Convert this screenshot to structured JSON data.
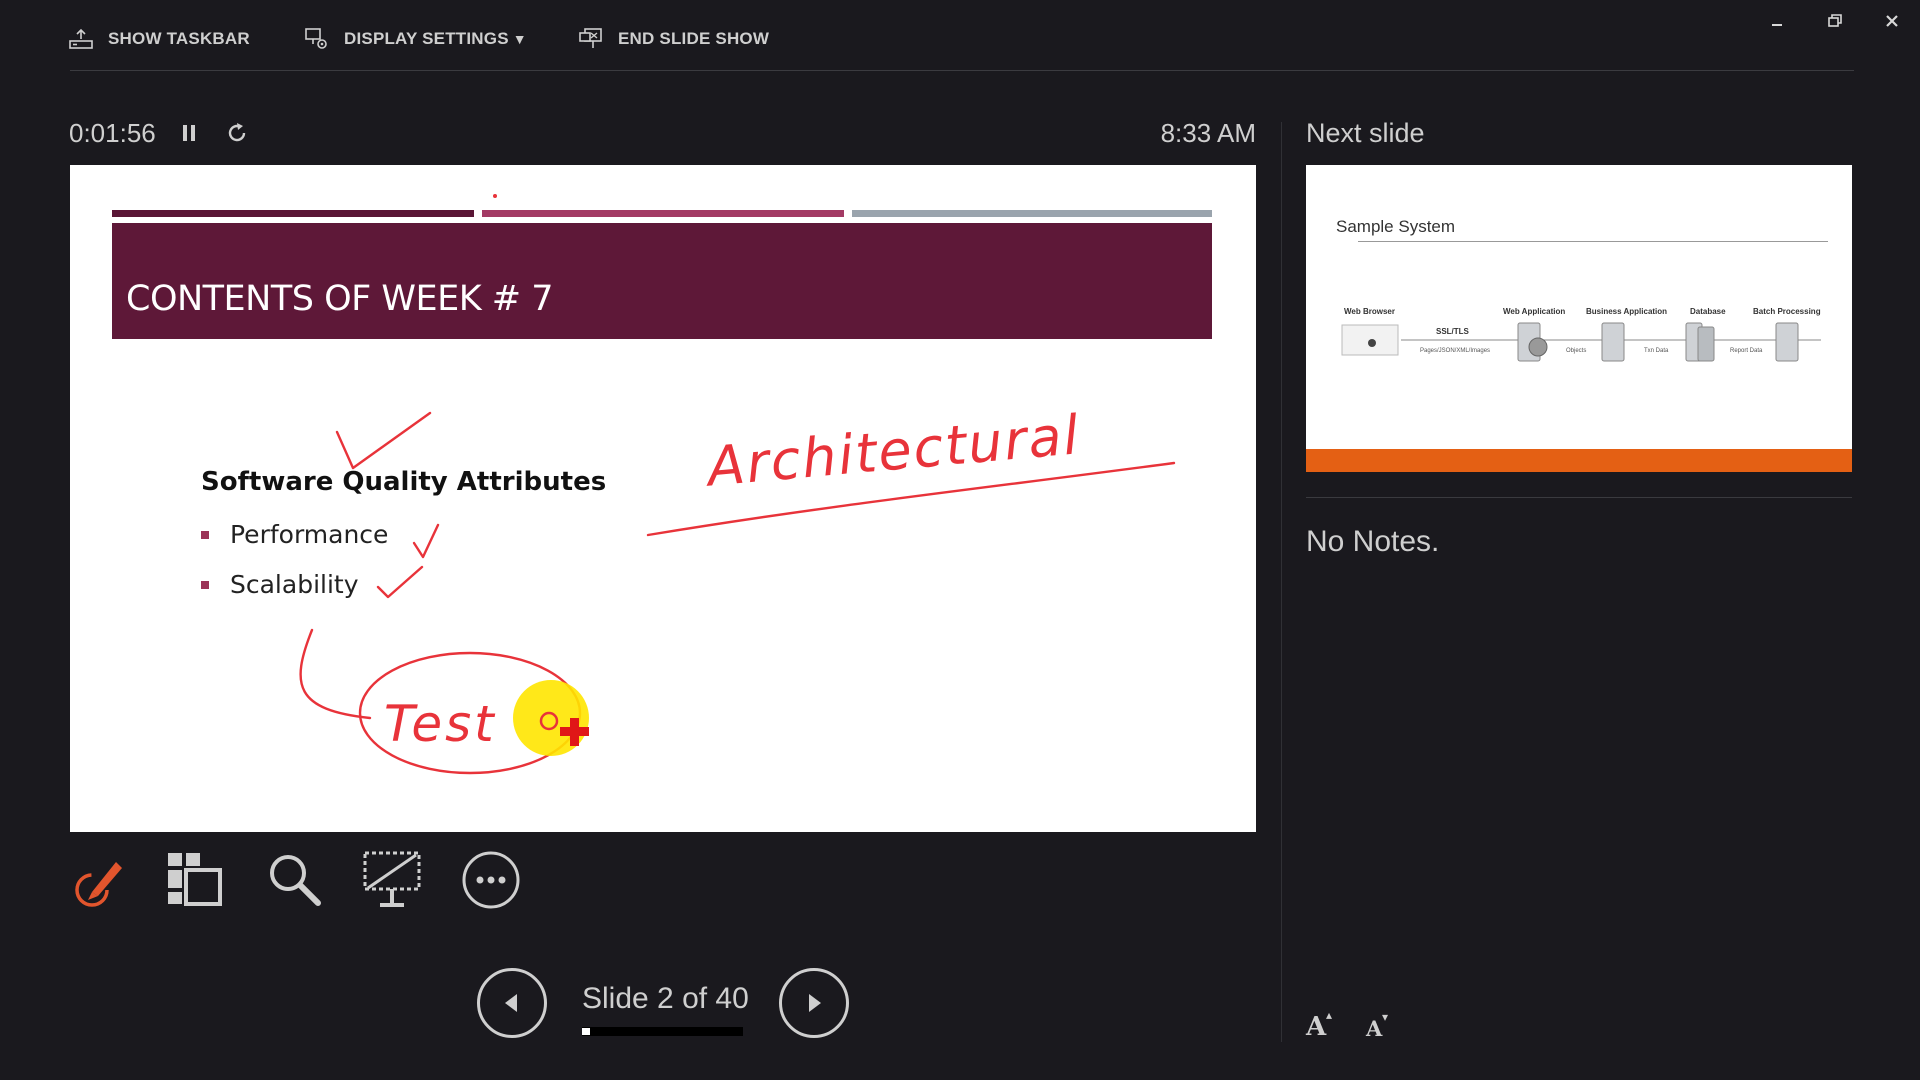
{
  "toolbar": {
    "show_taskbar": "SHOW TASKBAR",
    "display_settings": "DISPLAY SETTINGS",
    "end_slide_show": "END SLIDE SHOW",
    "dropdown_glyph": "▼"
  },
  "window": {
    "minimize": "minimize-icon",
    "restore": "restore-icon",
    "close": "close-icon"
  },
  "presenter": {
    "elapsed": "0:01:56",
    "clock": "8:33 AM",
    "next_slide_label": "Next slide",
    "notes": "No Notes.",
    "slide_counter": "Slide 2 of 40",
    "progress_fraction": 0.05
  },
  "slide": {
    "title": "CONTENTS OF WEEK # 7",
    "heading": "Software Quality Attributes",
    "bullets": [
      "Performance",
      "Scalability"
    ],
    "ink_words": [
      "Architectural",
      "Test"
    ],
    "colors": {
      "band": "#5e1838",
      "stripe_1": "#5a1535",
      "stripe_2": "#a33a64",
      "stripe_3": "#9aa4ad",
      "ink": "#e8333a"
    }
  },
  "next_slide": {
    "title": "Sample System",
    "labels": [
      "Web Browser",
      "SSL/TLS",
      "Web Application",
      "Business Application",
      "Database",
      "Batch Processing"
    ],
    "small_labels": [
      "Pages/JSON/XML/Images",
      "Objects",
      "Txn Data",
      "Report Data"
    ],
    "accent": "#e46014"
  },
  "tools": [
    "pen-tool-icon",
    "see-all-slides-icon",
    "zoom-icon",
    "black-screen-icon",
    "more-options-icon"
  ],
  "font_buttons": {
    "increase": "A",
    "decrease": "A"
  }
}
